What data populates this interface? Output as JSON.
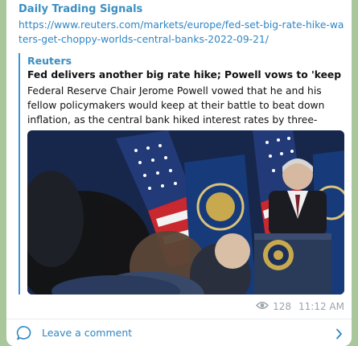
{
  "message": {
    "channel": "Daily Trading Signals",
    "link": "https://www.reuters.com/markets/europe/fed-set-big-rate-hike-waters-get-choppy-worlds-central-banks-2022-09-21/"
  },
  "preview": {
    "site": "Reuters",
    "headline": "Fed delivers another big rate hike; Powell vows to 'keep at it'",
    "description": "Federal Reserve Chair Jerome Powell vowed that he and his fellow policymakers would keep at their battle to beat down inflation, as the central bank hiked interest rates by three-quarters of a perce..."
  },
  "footer": {
    "views": "128",
    "time": "11:12 AM",
    "comment_label": "Leave a comment"
  },
  "icons": {
    "views": "eye-icon",
    "comment": "comment-bubble-icon",
    "chevron": "chevron-right-icon"
  },
  "colors": {
    "accent": "#2f86c5",
    "chat_background": "#a9c79a"
  }
}
